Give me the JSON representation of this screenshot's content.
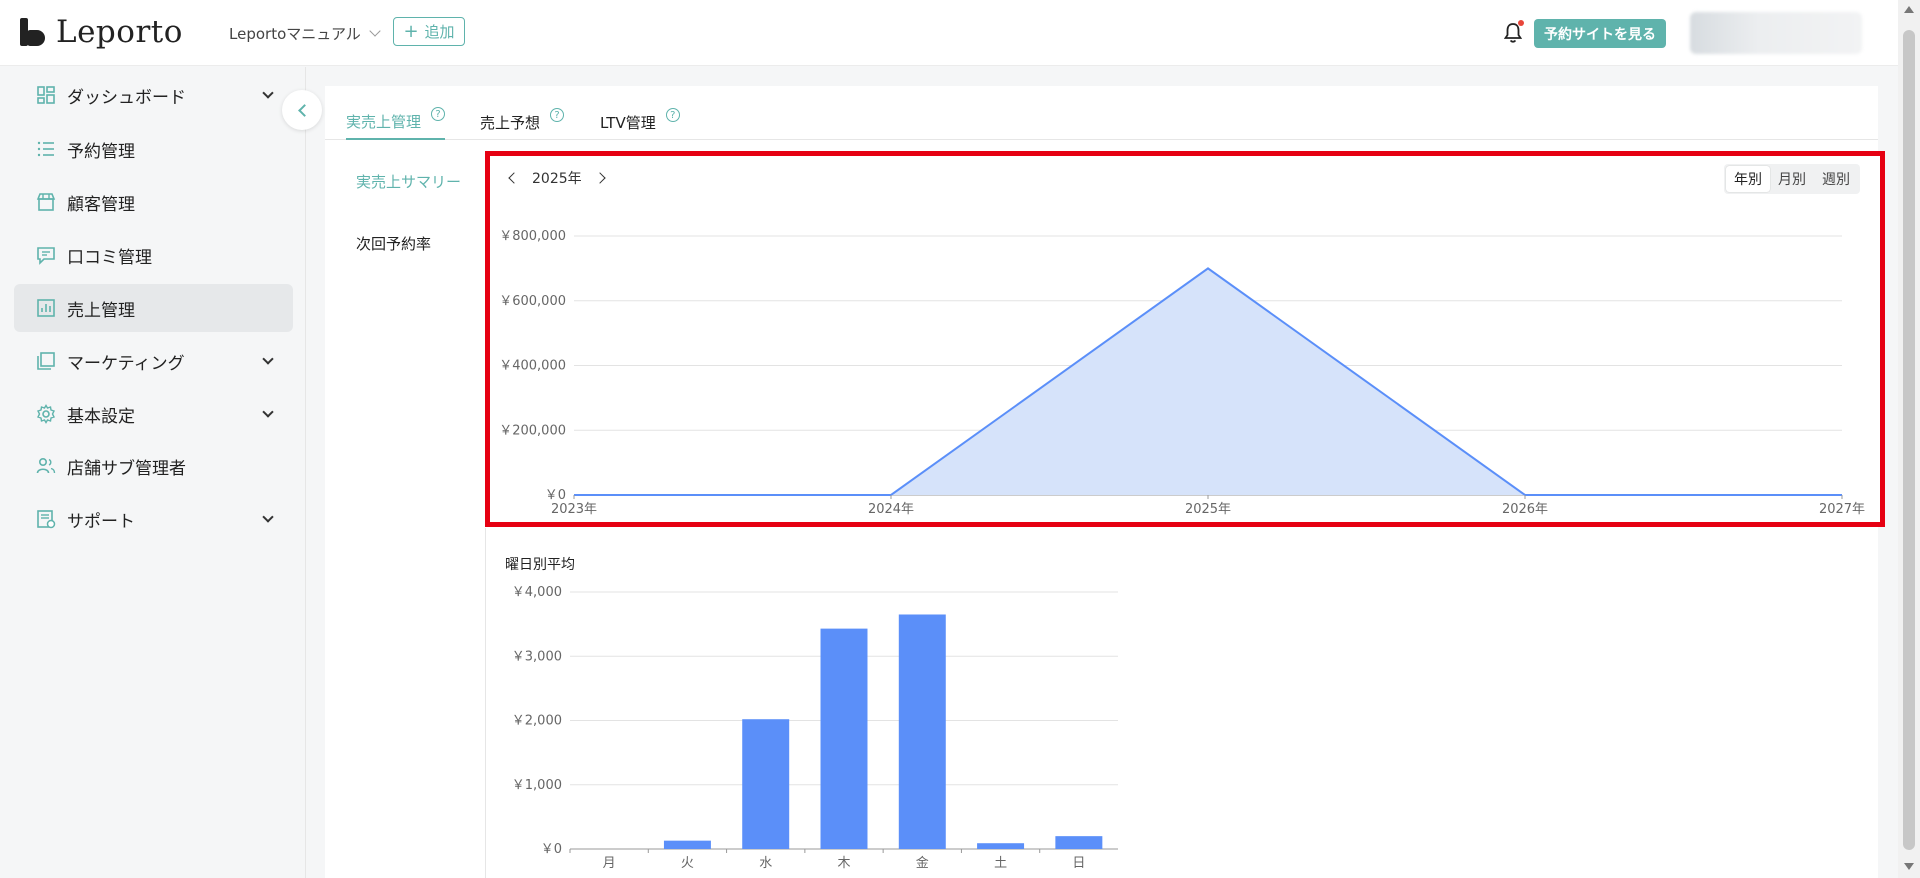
{
  "header": {
    "logo_text": "Leporto",
    "store_name": "Leportoマニュアル",
    "add_label": "追加",
    "view_site_label": "予約サイトを見る"
  },
  "sidebar": {
    "items": [
      {
        "label": "ダッシュボード",
        "icon": "dashboard-icon",
        "expandable": true
      },
      {
        "label": "予約管理",
        "icon": "list-icon",
        "expandable": false
      },
      {
        "label": "顧客管理",
        "icon": "store-icon",
        "expandable": false
      },
      {
        "label": "口コミ管理",
        "icon": "comment-icon",
        "expandable": false
      },
      {
        "label": "売上管理",
        "icon": "chart-icon",
        "expandable": false,
        "active": true
      },
      {
        "label": "マーケティング",
        "icon": "layers-icon",
        "expandable": true
      },
      {
        "label": "基本設定",
        "icon": "gear-icon",
        "expandable": true
      },
      {
        "label": "店舗サブ管理者",
        "icon": "users-icon",
        "expandable": false
      },
      {
        "label": "サポート",
        "icon": "support-icon",
        "expandable": true
      }
    ]
  },
  "tabs": [
    {
      "label": "実売上管理",
      "active": true
    },
    {
      "label": "売上予想",
      "active": false
    },
    {
      "label": "LTV管理",
      "active": false
    }
  ],
  "subnav": [
    {
      "label": "実売上サマリー",
      "active": true
    },
    {
      "label": "次回予約率",
      "active": false
    }
  ],
  "year_nav": {
    "current": "2025年"
  },
  "period_toggle": [
    "年別",
    "月別",
    "週別"
  ],
  "colors": {
    "accent": "#5fb3ac",
    "series": "#5b8ff9",
    "area": "#d6e3fa",
    "highlight": "#e60012"
  },
  "chart_data": [
    {
      "type": "area",
      "x": [
        "2023年",
        "2024年",
        "2025年",
        "2026年",
        "2027年"
      ],
      "values": [
        0,
        0,
        700000,
        0,
        0
      ],
      "y_ticks": [
        "￥0",
        "￥200,000",
        "￥400,000",
        "￥600,000",
        "￥800,000"
      ],
      "ylim": [
        0,
        800000
      ],
      "grid": true
    },
    {
      "type": "bar",
      "title": "曜日別平均",
      "categories": [
        "月",
        "火",
        "水",
        "木",
        "金",
        "土",
        "日"
      ],
      "values": [
        0,
        130,
        2020,
        3430,
        3650,
        90,
        200
      ],
      "y_ticks": [
        "￥0",
        "￥1,000",
        "￥2,000",
        "￥3,000",
        "￥4,000"
      ],
      "ylim": [
        0,
        4000
      ],
      "grid": true
    }
  ]
}
